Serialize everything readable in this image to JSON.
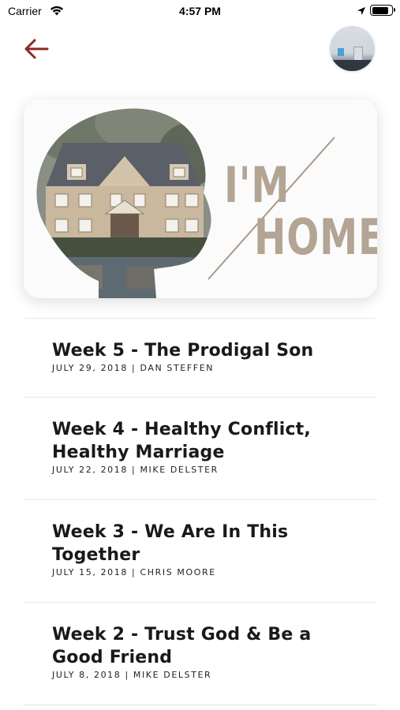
{
  "status_bar": {
    "carrier": "Carrier",
    "time": "4:57 PM",
    "icons": [
      "wifi-icon",
      "location-arrow-icon",
      "battery-icon"
    ]
  },
  "nav": {
    "back_icon": "arrow-left-icon",
    "back_color": "#8b2a22",
    "avatar": "user-avatar"
  },
  "hero": {
    "line1": "I'M",
    "line2": "HOME",
    "accent_color": "#b3a493"
  },
  "sermons": [
    {
      "title": "Week 5 - The Prodigal Son",
      "meta": "JULY 29, 2018 | DAN STEFFEN"
    },
    {
      "title": "Week 4 - Healthy Conflict, Healthy Marriage",
      "meta": "JULY 22, 2018 | MIKE DELSTER"
    },
    {
      "title": "Week 3 - We Are In This Together",
      "meta": "JULY 15, 2018 | CHRIS MOORE"
    },
    {
      "title": "Week 2 - Trust God & Be a Good Friend",
      "meta": "JULY 8, 2018 | MIKE DELSTER"
    }
  ]
}
